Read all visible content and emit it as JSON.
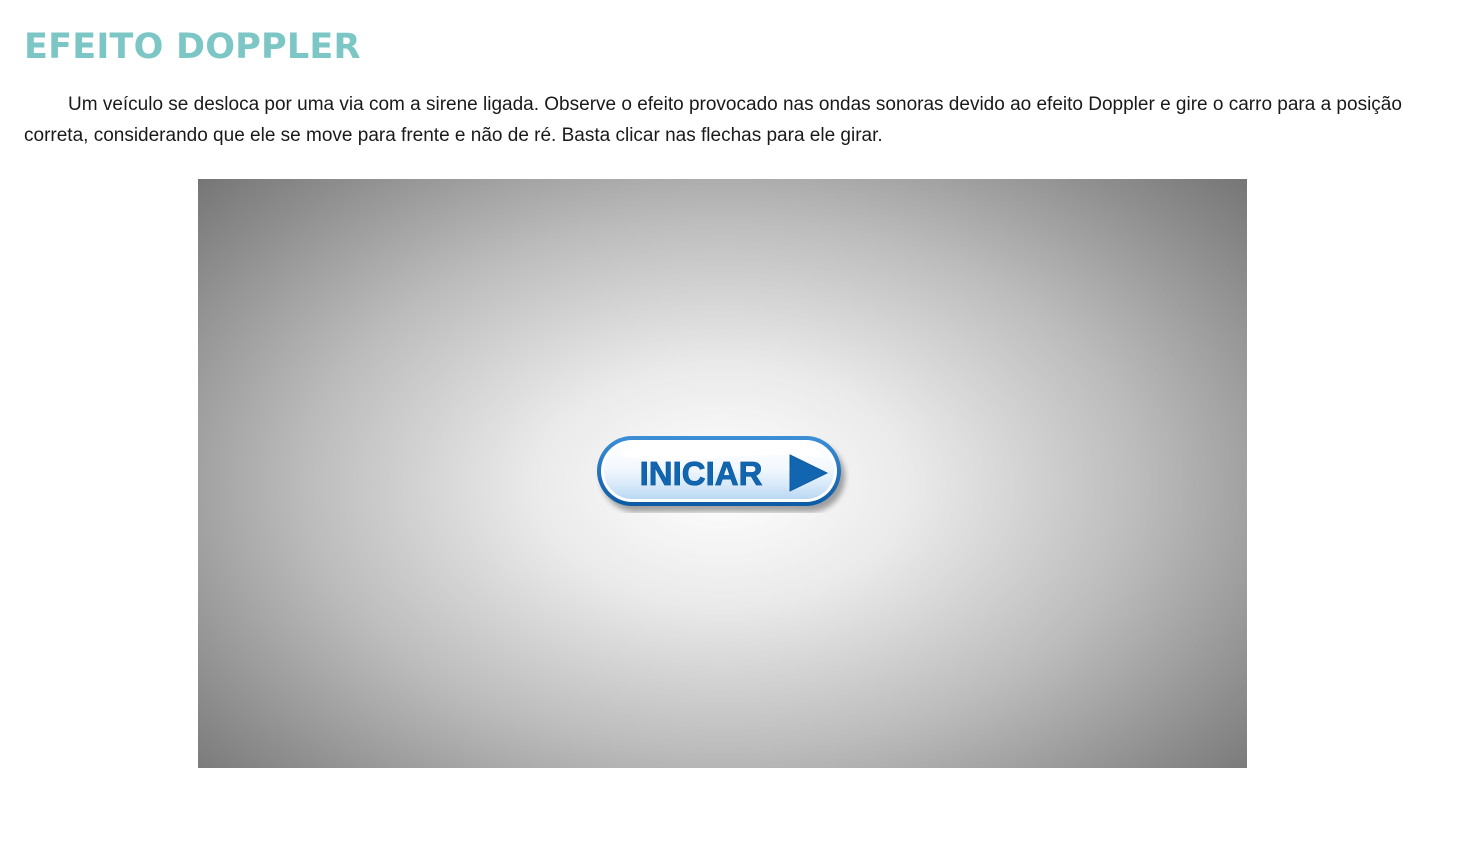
{
  "page": {
    "title": "EFEITO DOPPLER",
    "intro": "Um veículo se desloca por uma via com a sirene ligada. Observe o efeito provocado nas ondas sonoras devido ao efeito Doppler e gire o carro para a posição correta, considerando que ele se move para frente e não de ré. Basta clicar nas flechas para ele girar."
  },
  "stage": {
    "start_label": "INICIAR",
    "start_icon": "play-triangle-icon"
  },
  "colors": {
    "title": "#7cc6c5",
    "button_text": "#1266b0",
    "button_border": "#1a6cb3",
    "stage_center": "#ffffff",
    "stage_edge": "#6b6b6b"
  }
}
